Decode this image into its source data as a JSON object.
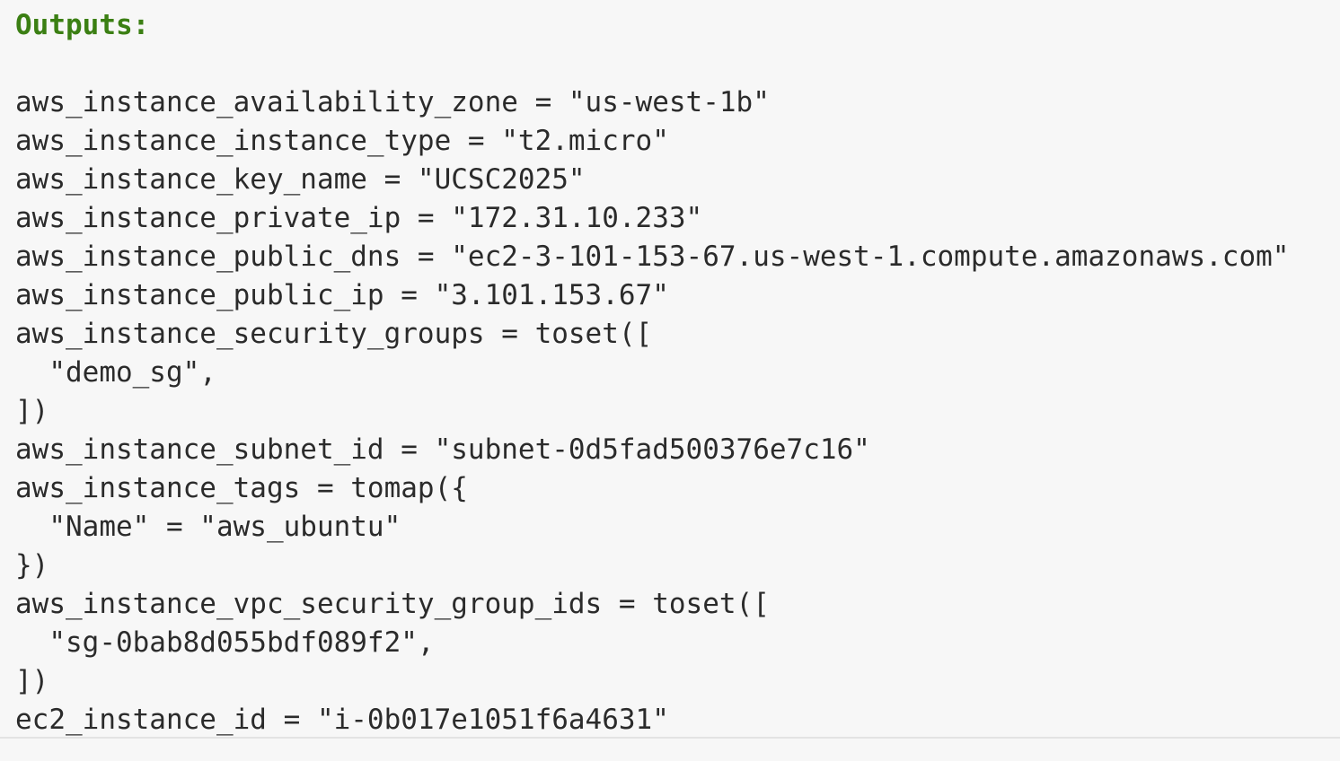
{
  "terminal": {
    "header": "Outputs:",
    "accent_color": "#3b7f13",
    "lines": [
      "aws_instance_availability_zone = \"us-west-1b\"",
      "aws_instance_instance_type = \"t2.micro\"",
      "aws_instance_key_name = \"UCSC2025\"",
      "aws_instance_private_ip = \"172.31.10.233\"",
      "aws_instance_public_dns = \"ec2-3-101-153-67.us-west-1.compute.amazonaws.com\"",
      "aws_instance_public_ip = \"3.101.153.67\"",
      "aws_instance_security_groups = toset([",
      "  \"demo_sg\",",
      "])",
      "aws_instance_subnet_id = \"subnet-0d5fad500376e7c16\"",
      "aws_instance_tags = tomap({",
      "  \"Name\" = \"aws_ubuntu\"",
      "})",
      "aws_instance_vpc_security_group_ids = toset([",
      "  \"sg-0bab8d055bdf089f2\",",
      "])",
      "ec2_instance_id = \"i-0b017e1051f6a4631\""
    ]
  }
}
